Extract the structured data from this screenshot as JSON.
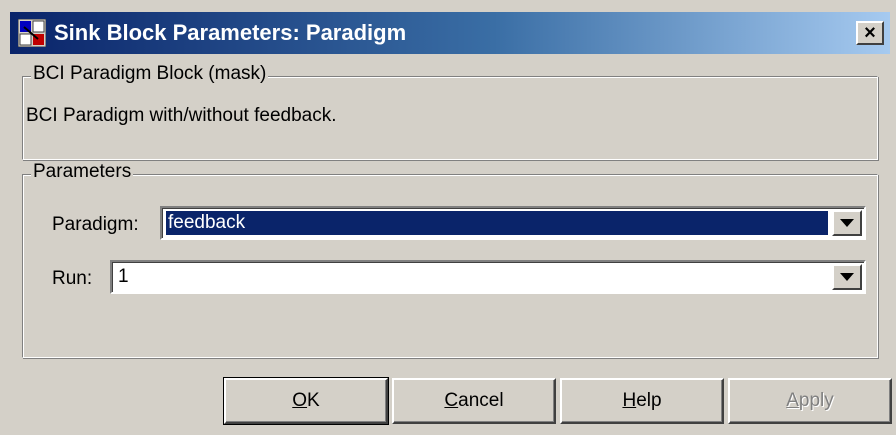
{
  "window": {
    "title": "Sink Block Parameters: Paradigm",
    "icon": "simulink-block-icon",
    "close_label": "×"
  },
  "mask_group": {
    "legend": "BCI Paradigm Block (mask)",
    "description": "BCI Paradigm with/without feedback."
  },
  "parameters_group": {
    "legend": "Parameters",
    "paradigm": {
      "label": "Paradigm:",
      "value": "feedback"
    },
    "run": {
      "label": "Run:",
      "value": "1"
    }
  },
  "buttons": {
    "ok": {
      "mnemonic": "O",
      "rest": "K"
    },
    "cancel": {
      "mnemonic": "C",
      "rest": "ancel"
    },
    "help": {
      "mnemonic": "H",
      "rest": "elp"
    },
    "apply": {
      "mnemonic": "A",
      "rest": "pply",
      "enabled": false
    }
  },
  "colors": {
    "titlebar_start": "#0a246a",
    "titlebar_end": "#a6caf0",
    "dialog_bg": "#d4d0c8",
    "selection_bg": "#0a246a"
  }
}
